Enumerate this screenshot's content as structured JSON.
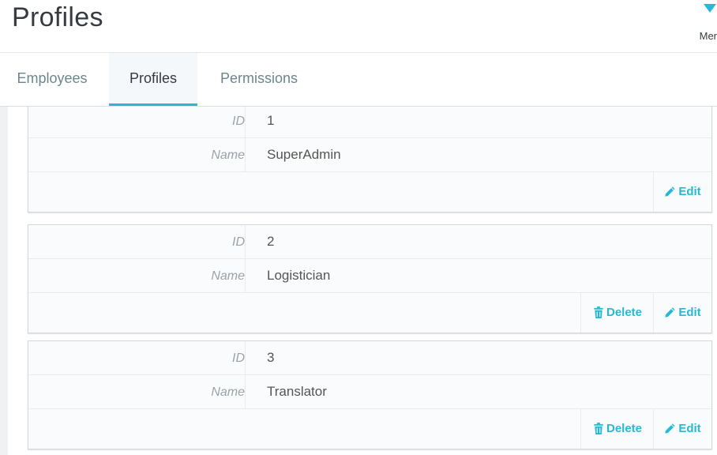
{
  "header": {
    "title": "Profiles",
    "menu_label": "Mer"
  },
  "tabs": [
    {
      "label": "Employees"
    },
    {
      "label": "Profiles"
    },
    {
      "label": "Permissions"
    }
  ],
  "fields": {
    "id_label": "ID",
    "name_label": "Name"
  },
  "profiles": [
    {
      "id": "1",
      "name": "SuperAdmin",
      "edit": "Edit"
    },
    {
      "id": "2",
      "name": "Logistician",
      "delete": "Delete",
      "edit": "Edit"
    },
    {
      "id": "3",
      "name": "Translator",
      "delete": "Delete",
      "edit": "Edit"
    }
  ],
  "colors": {
    "accent": "#25b9d7",
    "title": "#363a41"
  }
}
